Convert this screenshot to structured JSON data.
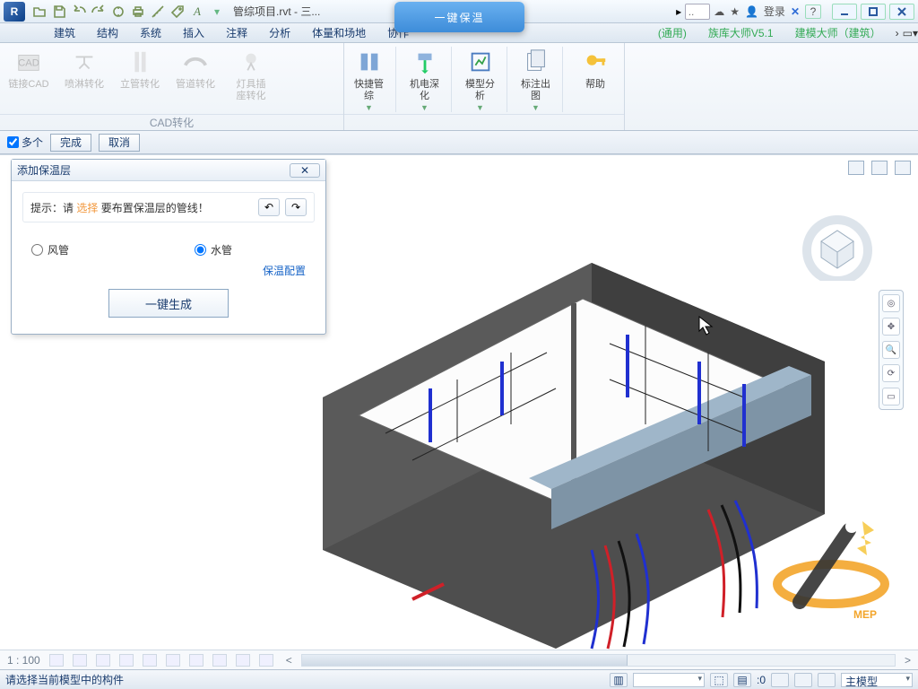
{
  "titlebar": {
    "app_initial": "R",
    "file_title": "管综项目.rvt - 三...",
    "search_placeholder": "..",
    "login_label": "登录",
    "help_glyph": "?"
  },
  "tooltip": {
    "text": "一键保温"
  },
  "menutabs": {
    "items": [
      "建筑",
      "结构",
      "系统",
      "插入",
      "注释",
      "分析",
      "体量和场地",
      "协作"
    ],
    "extras": [
      "(通用)",
      "族库大师V5.1",
      "建模大师（建筑）"
    ],
    "more_glyph": "›"
  },
  "ribbon": {
    "panel_cad": {
      "label": "CAD转化",
      "items": [
        {
          "id": "link-cad",
          "text": "链接CAD"
        },
        {
          "id": "spray",
          "text": "喷淋转化"
        },
        {
          "id": "riser",
          "text": "立管转化"
        },
        {
          "id": "pipe",
          "text": "管道转化"
        },
        {
          "id": "fixture",
          "text": "灯具插\n座转化"
        }
      ]
    },
    "panel_tools": {
      "items": [
        {
          "id": "quickpipe",
          "text": "快捷管综"
        },
        {
          "id": "mep-deep",
          "text": "机电深化"
        },
        {
          "id": "model-an",
          "text": "模型分析"
        },
        {
          "id": "annot",
          "text": "标注出图"
        },
        {
          "id": "help",
          "text": "帮助"
        }
      ]
    }
  },
  "optbar": {
    "multi_label": "多个",
    "finish": "完成",
    "cancel": "取消"
  },
  "dialog": {
    "title": "添加保温层",
    "close_glyph": "✕",
    "hint_prefix": "提示：请 ",
    "hint_hl": "选择",
    "hint_suffix": " 要布置保温层的管线！",
    "undo_glyph": "↶",
    "redo_glyph": "↷",
    "radio_duct": "风管",
    "radio_pipe": "水管",
    "config_link": "保温配置",
    "generate": "一键生成"
  },
  "viewbar": {
    "scale": "1 : 100"
  },
  "status": {
    "message": "请选择当前模型中的构件",
    "zero": ":0",
    "model_label": "主模型"
  },
  "watermark": {
    "text": "MEP"
  }
}
